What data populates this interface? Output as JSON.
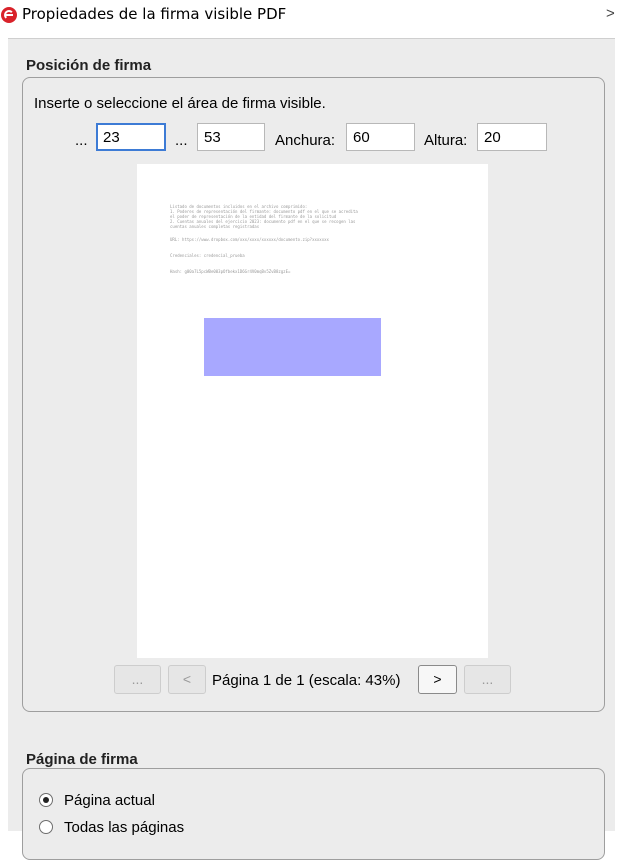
{
  "window": {
    "title": "Propiedades de la firma visible PDF",
    "chevron": ">"
  },
  "position_section": {
    "title": "Posición de firma",
    "instruction": "Inserte o seleccione el área de firma visible.",
    "x_label": "...",
    "x_value": "23",
    "y_label": "...",
    "y_value": "53",
    "width_label": "Anchura:",
    "width_value": "60",
    "height_label": "Altura:",
    "height_value": "20"
  },
  "preview": {
    "lines": [
      "Listado de documentos incluidos en el archivo comprimido:",
      "1. Poderes de representación del firmante: documento pdf en el que se acredita",
      "el poder de representación de la entidad del firmante de la solicitud",
      "2. Cuentas anuales del ejercicio 2023: documento pdf en el que se recogen las",
      "cuentas anuales completas registradas",
      "URL: https://www.dropbox.com/xxx/xxxx/xxxxxx/documento.zip?xxxxxxx",
      "Credenciales: credencial_prueba",
      "Hash: g00a7L5pcWBe003pOfbekx1D6Gr4V0mqBv5ZvB8zgzE="
    ]
  },
  "navigation": {
    "first_label": "...",
    "prev_label": "<",
    "page_status": "Página 1 de 1 (escala: 43%)",
    "next_label": ">",
    "last_label": "..."
  },
  "page_section": {
    "title": "Página de firma",
    "options": [
      {
        "label": "Página actual",
        "checked": true
      },
      {
        "label": "Todas las páginas",
        "checked": false
      }
    ]
  },
  "colors": {
    "signature_area": "#a8a8ff",
    "active_field_border": "#3d7bd5",
    "app_icon": "#d9222a"
  }
}
